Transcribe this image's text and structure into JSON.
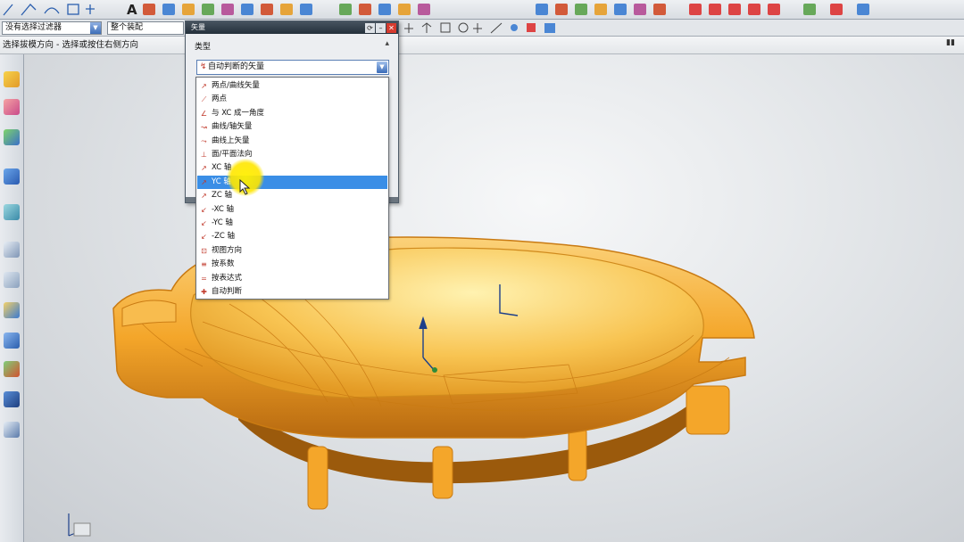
{
  "toolbar": {
    "text_tool": "A",
    "icons": [
      "line-icon",
      "arc-icon",
      "rectangle-icon",
      "text-icon",
      "sketch-icon",
      "feature-icon",
      "sync-icon",
      "edit-icon",
      "snap-icon",
      "view-icon",
      "render-icon",
      "analysis-icon"
    ]
  },
  "selection_bar": {
    "filter_combo": "没有选择过滤器",
    "scope_combo": "整个装配"
  },
  "cue_line": "选择拔模方向 - 选择或按住右侧方向",
  "dialog": {
    "title": "矢量",
    "group_label": "类型",
    "type_value": "自动判断的矢量"
  },
  "dropdown": {
    "selected_index": 7,
    "options": [
      {
        "label": "两点/曲线矢量",
        "icon": "vector-icon"
      },
      {
        "label": "两点",
        "icon": "two-points-icon"
      },
      {
        "label": "与 XC 成一角度",
        "icon": "angle-icon"
      },
      {
        "label": "曲线/轴矢量",
        "icon": "curve-icon"
      },
      {
        "label": "曲线上矢量",
        "icon": "curve-vector-icon"
      },
      {
        "label": "面/平面法向",
        "icon": "face-normal-icon"
      },
      {
        "label": "XC 轴",
        "icon": "xc-axis-icon"
      },
      {
        "label": "YC 轴",
        "icon": "yc-axis-icon"
      },
      {
        "label": "ZC 轴",
        "icon": "zc-axis-icon"
      },
      {
        "label": "-XC 轴",
        "icon": "neg-xc-axis-icon"
      },
      {
        "label": "-YC 轴",
        "icon": "neg-yc-axis-icon"
      },
      {
        "label": "-ZC 轴",
        "icon": "neg-zc-axis-icon"
      },
      {
        "label": "视图方向",
        "icon": "view-direction-icon"
      },
      {
        "label": "按系数",
        "icon": "coefficient-icon"
      },
      {
        "label": "按表达式",
        "icon": "expression-icon"
      },
      {
        "label": "自动判断",
        "icon": "infer-icon"
      }
    ]
  },
  "colors": {
    "part": "#f4a62a",
    "part_dark": "#c97a12",
    "selection": "#3a8ee6",
    "cursor_halo": "#ffe600"
  }
}
